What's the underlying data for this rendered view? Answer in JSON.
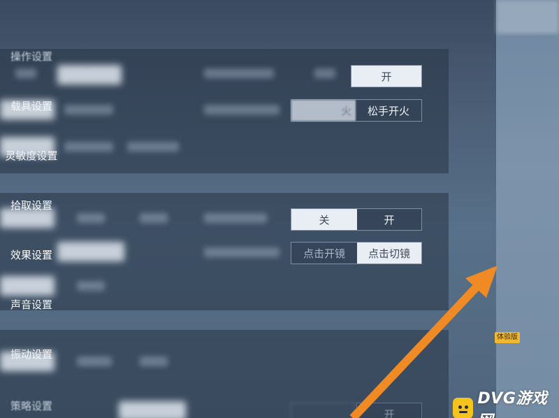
{
  "section_top": {
    "fire_mode": {
      "options": [
        "火",
        "松手开火"
      ],
      "selected_index": 0
    },
    "toggle_top": {
      "options": [
        "开"
      ],
      "selected_index": 0
    }
  },
  "section_scope": {
    "toggle": {
      "options": [
        "关",
        "开"
      ],
      "selected_index": 0
    },
    "scope_mode": {
      "options": [
        "点击开镜",
        "点击切镜"
      ],
      "selected_index": 1
    }
  },
  "section_bottom": {
    "toggle": {
      "options": [
        "开"
      ]
    }
  },
  "sidebar": {
    "items": [
      {
        "label": "操作设置"
      },
      {
        "label": "载具设置"
      },
      {
        "label": "灵敏度设置"
      },
      {
        "label": "拾取设置"
      },
      {
        "label": "效果设置",
        "highlighted": true
      },
      {
        "label": "声音设置"
      },
      {
        "label": "振动设置",
        "badge": "体验版"
      },
      {
        "label": "策略设置"
      }
    ]
  },
  "annotation": {
    "arrow_color": "#f08a24",
    "points_to": "效果设置"
  },
  "watermark": {
    "text": "DVG游戏网",
    "icon": "game-face-icon"
  }
}
